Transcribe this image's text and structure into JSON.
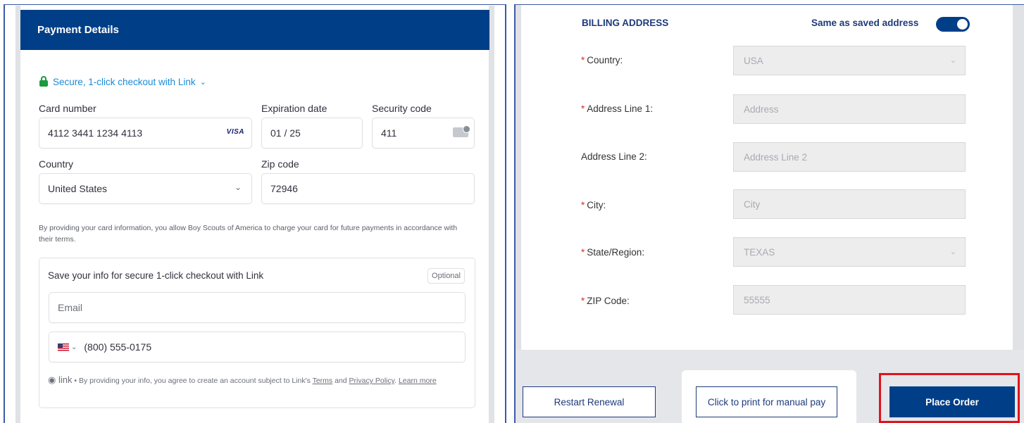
{
  "payment": {
    "header": "Payment Details",
    "link_checkout": "Secure, 1-click checkout with Link",
    "card_number_label": "Card number",
    "card_number_value": "4112 3441 1234 4113",
    "card_brand": "VISA",
    "expiration_label": "Expiration date",
    "expiration_value": "01 / 25",
    "security_label": "Security code",
    "security_value": "411",
    "country_label": "Country",
    "country_value": "United States",
    "zip_label": "Zip code",
    "zip_value": "72946",
    "terms": "By providing your card information, you allow Boy Scouts of America to charge your card for future payments in accordance with their terms.",
    "save_title": "Save your info for secure 1-click checkout with Link",
    "optional": "Optional",
    "email_placeholder": "Email",
    "phone_value": "(800) 555-0175",
    "link_brand": "link",
    "legal_prefix": " • By providing your info, you agree to create an account subject to Link's ",
    "legal_terms": "Terms",
    "legal_and": " and ",
    "legal_privacy": "Privacy Policy",
    "legal_sep": ". ",
    "legal_learn": "Learn more"
  },
  "billing": {
    "title": "BILLING ADDRESS",
    "same_label": "Same as saved address",
    "toggle_on": true,
    "fields": [
      {
        "label": "Country:",
        "value": "USA",
        "required": true
      },
      {
        "label": "Address Line 1:",
        "value": "Address",
        "required": true
      },
      {
        "label": "Address Line 2:",
        "value": "Address Line 2",
        "required": false
      },
      {
        "label": "City:",
        "value": "City",
        "required": true
      },
      {
        "label": "State/Region:",
        "value": "TEXAS",
        "required": true
      },
      {
        "label": "ZIP Code:",
        "value": "55555",
        "required": true
      }
    ],
    "required_mark": "*"
  },
  "actions": {
    "restart": "Restart Renewal",
    "print": "Click to print for manual pay",
    "place": "Place Order"
  },
  "colors": {
    "brand_navy": "#003f87",
    "link_blue": "#1b8ad8",
    "lock_green": "#1a9a41",
    "required_red": "#e0282e",
    "highlight_red": "#e0131b"
  }
}
